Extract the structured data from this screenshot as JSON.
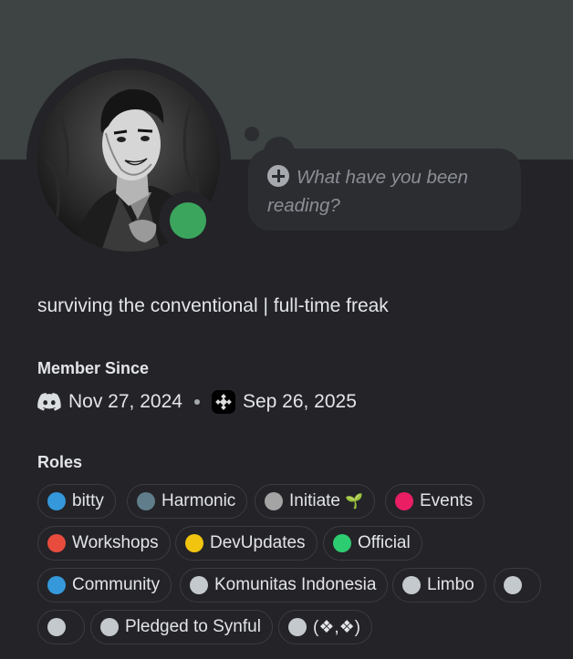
{
  "thought": {
    "line1": "What have you been",
    "line2": "reading?",
    "icon": "plus-circle-icon"
  },
  "bio": "surviving the conventional | full-time freak",
  "member_since": {
    "title": "Member Since",
    "discord_date": "Nov 27, 2024",
    "discord_icon": "discord-icon",
    "server_date": "Sep 26, 2025",
    "server_icon": "server-icon"
  },
  "roles": {
    "title": "Roles",
    "items": [
      {
        "label": "bitty",
        "color": "#3498db"
      },
      {
        "label": "Harmonic",
        "color": "#607d8b"
      },
      {
        "label": "Initiate",
        "color": "#a4a4a4",
        "suffix_icon": "seedling-icon",
        "suffix": "🌱"
      },
      {
        "label": "Events",
        "color": "#e91e63"
      },
      {
        "label": "Workshops",
        "color": "#e74c3c"
      },
      {
        "label": "DevUpdates",
        "color": "#f1c40f"
      },
      {
        "label": "Official",
        "color": "#2ecc71"
      },
      {
        "label": "Community",
        "color": "#3498db"
      },
      {
        "label": "Komunitas Indonesia",
        "color": "#c4c9ce"
      },
      {
        "label": "Limbo",
        "color": "#c4c9ce"
      },
      {
        "label": "",
        "color": "#c4c9ce"
      },
      {
        "label": "",
        "color": "#c4c9ce"
      },
      {
        "label": "Pledged to Synful",
        "color": "#c4c9ce"
      },
      {
        "label": "(❖,❖)",
        "color": "#c4c9ce"
      }
    ]
  },
  "status": {
    "state": "online",
    "color": "#3ba55d"
  }
}
